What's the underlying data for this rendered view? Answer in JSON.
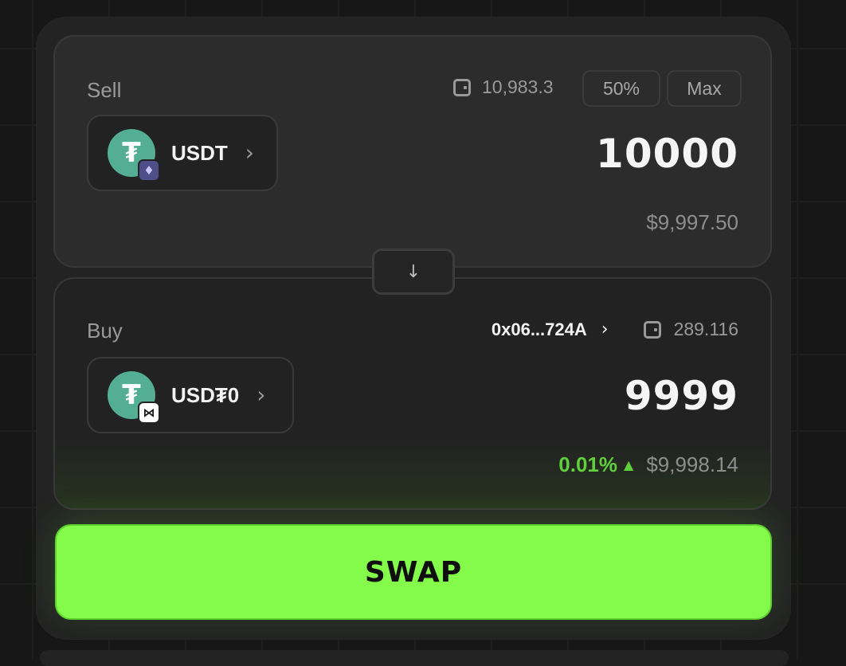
{
  "sell": {
    "label": "Sell",
    "balance": "10,983.3",
    "pct_button": "50%",
    "max_button": "Max",
    "token_symbol": "USDT",
    "token_logo_glyph": "₮",
    "chain_badge_glyph": "♦",
    "amount": "10000",
    "usd_value": "$9,997.50"
  },
  "buy": {
    "label": "Buy",
    "address": "0x06...724A",
    "balance": "289.116",
    "token_symbol": "USD₮0",
    "token_logo_glyph": "₮",
    "chain_badge_glyph": "⋈",
    "amount": "9999",
    "pct_change": "0.01%",
    "usd_value": "$9,998.14"
  },
  "swap_direction_icon": "↓",
  "swap_button_label": "SWAP",
  "colors": {
    "accent": "#84fa4a",
    "positive": "#5fcf3b",
    "usdt": "#53ae94"
  }
}
